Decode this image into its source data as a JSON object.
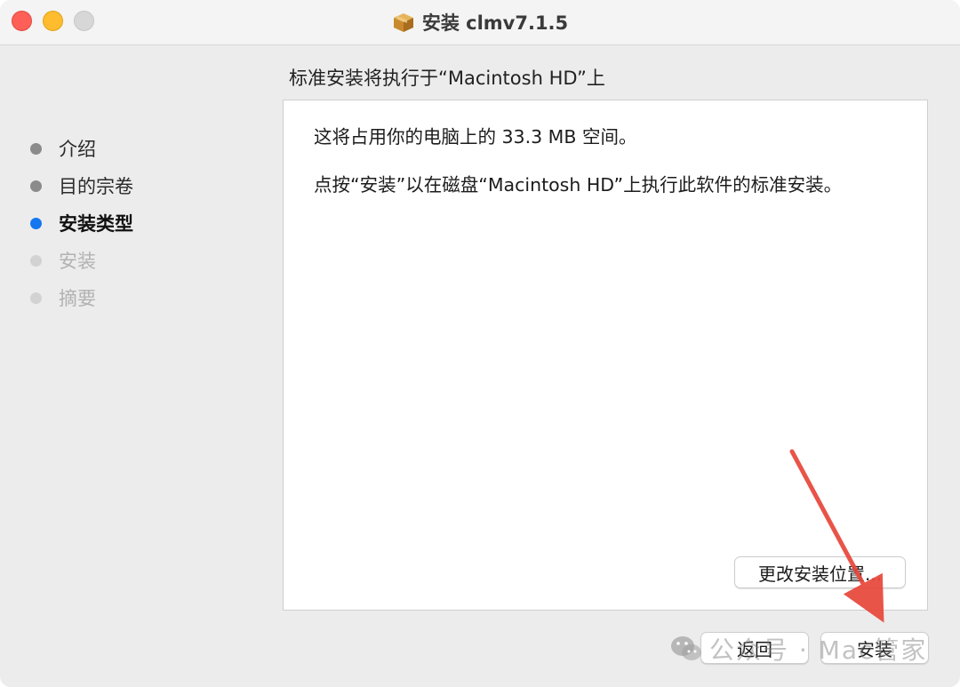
{
  "window": {
    "title": "安装 clmv7.1.5",
    "title_icon": "package-box-icon"
  },
  "header": {
    "subtitle": "标准安装将执行于“Macintosh HD”上"
  },
  "sidebar": {
    "steps": [
      {
        "label": "介绍",
        "state": "done"
      },
      {
        "label": "目的宗卷",
        "state": "done"
      },
      {
        "label": "安装类型",
        "state": "current"
      },
      {
        "label": "安装",
        "state": "future"
      },
      {
        "label": "摘要",
        "state": "future"
      }
    ]
  },
  "content": {
    "line1": "这将占用你的电脑上的 33.3 MB 空间。",
    "line2": "点按“安装”以在磁盘“Macintosh HD”上执行此软件的标准安装。"
  },
  "buttons": {
    "change_location": "更改安装位置...",
    "back": "返回",
    "install": "安装"
  },
  "watermark": {
    "text": "公众号 · Mac管家"
  },
  "colors": {
    "accent": "#1577ef",
    "arrow": "#e8463a"
  }
}
